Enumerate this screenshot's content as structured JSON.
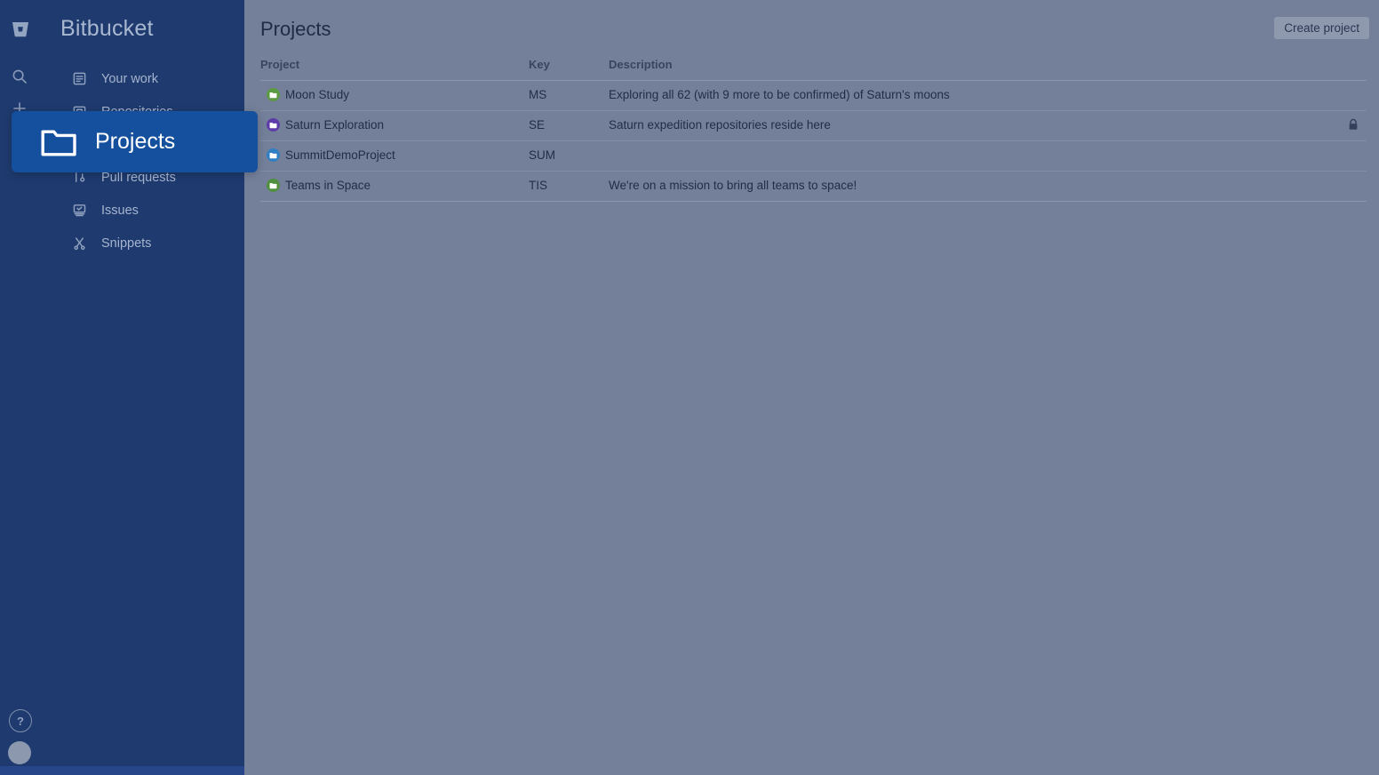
{
  "brand": {
    "name": "Bitbucket",
    "logo_icon": "bitbucket-logo-icon"
  },
  "rail": {
    "search_icon": "search-icon",
    "create_icon": "plus-icon",
    "help_label": "?",
    "help_icon": "help-icon",
    "avatar_icon": "user-avatar"
  },
  "sidebar": {
    "items": [
      {
        "label": "Your work",
        "icon": "your-work-icon"
      },
      {
        "label": "Repositories",
        "icon": "repositories-icon"
      },
      {
        "label": "Projects",
        "icon": "projects-folder-icon"
      },
      {
        "label": "Pull requests",
        "icon": "pull-requests-icon"
      },
      {
        "label": "Issues",
        "icon": "issues-icon"
      },
      {
        "label": "Snippets",
        "icon": "snippets-scissors-icon"
      }
    ]
  },
  "highlight": {
    "label": "Projects",
    "icon": "folder-icon",
    "background": "#15509e",
    "text_color": "#ffffff"
  },
  "main": {
    "title": "Projects",
    "create_button": "Create project",
    "table": {
      "headers": [
        "Project",
        "Key",
        "Description"
      ],
      "rows": [
        {
          "project": "Moon Study",
          "key": "MS",
          "description": "Exploring all 62 (with 9 more to be confirmed) of Saturn's moons",
          "avatar_color": "#5a9a42",
          "private": false
        },
        {
          "project": "Saturn Exploration",
          "key": "SE",
          "description": "Saturn expedition repositories reside here",
          "avatar_color": "#5e3ba8",
          "private": true
        },
        {
          "project": "SummitDemoProject",
          "key": "SUM",
          "description": "",
          "avatar_color": "#2f7fc4",
          "private": false
        },
        {
          "project": "Teams in Space",
          "key": "TIS",
          "description": "We're on a mission to bring all teams to space!",
          "avatar_color": "#4f8f3d",
          "private": false
        }
      ]
    }
  },
  "colors": {
    "sidebar_bg": "#1e3a6e",
    "content_dim_bg": "#74809a",
    "highlight_blue": "#15509e"
  }
}
